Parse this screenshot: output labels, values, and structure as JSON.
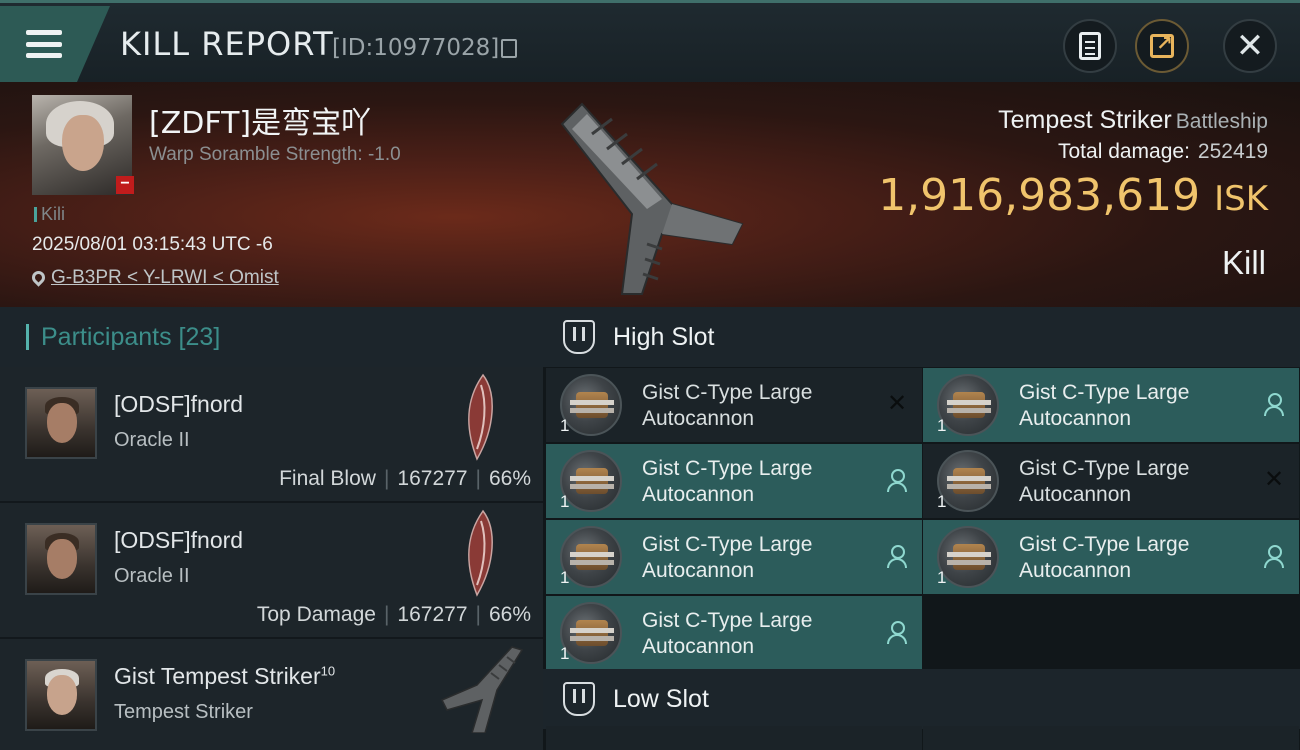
{
  "header": {
    "title": "KILL REPORT",
    "report_id": "[ID:10977028]"
  },
  "victim": {
    "name": "[ZDFT]是弯宝吖",
    "scramble": "Warp Soramble Strength: -1.0",
    "tag": "Kili",
    "timestamp": "2025/08/01 03:15:43 UTC -6",
    "location": "G-B3PR < Y-LRWI < Omist",
    "ship_name": "Tempest Striker",
    "ship_class": "Battleship",
    "total_damage_label": "Total damage:",
    "total_damage": "252419",
    "isk_value": "1,916,983,619",
    "isk_unit": "ISK",
    "result": "Kill"
  },
  "participants": {
    "label": "Participants [23]",
    "rows": [
      {
        "name": "[ODSF]fnord",
        "ship": "Oracle II",
        "stat_label": "Final Blow",
        "damage": "167277",
        "percent": "66%"
      },
      {
        "name": "[ODSF]fnord",
        "ship": "Oracle II",
        "stat_label": "Top Damage",
        "damage": "167277",
        "percent": "66%"
      },
      {
        "name": "Gist Tempest Striker",
        "name_sup": "10",
        "ship": "Tempest Striker"
      }
    ]
  },
  "fitting": {
    "high_slot_label": "High Slot",
    "low_slot_label": "Low Slot",
    "high_slot_modules": [
      {
        "name_line1": "Gist C-Type Large",
        "name_line2": "Autocannon",
        "qty": "1",
        "state": "destroyed"
      },
      {
        "name_line1": "Gist C-Type Large",
        "name_line2": "Autocannon",
        "qty": "1",
        "state": "dropped"
      },
      {
        "name_line1": "Gist C-Type Large",
        "name_line2": "Autocannon",
        "qty": "1",
        "state": "dropped"
      },
      {
        "name_line1": "Gist C-Type Large",
        "name_line2": "Autocannon",
        "qty": "1",
        "state": "destroyed"
      },
      {
        "name_line1": "Gist C-Type Large",
        "name_line2": "Autocannon",
        "qty": "1",
        "state": "dropped"
      },
      {
        "name_line1": "Gist C-Type Large",
        "name_line2": "Autocannon",
        "qty": "1",
        "state": "dropped"
      },
      {
        "name_line1": "Gist C-Type Large",
        "name_line2": "Autocannon",
        "qty": "1",
        "state": "dropped"
      }
    ]
  },
  "colors": {
    "accent_teal": "#2c5c5b",
    "isk_gold": "#f0c46c",
    "participants_label": "#3c8e8a"
  }
}
